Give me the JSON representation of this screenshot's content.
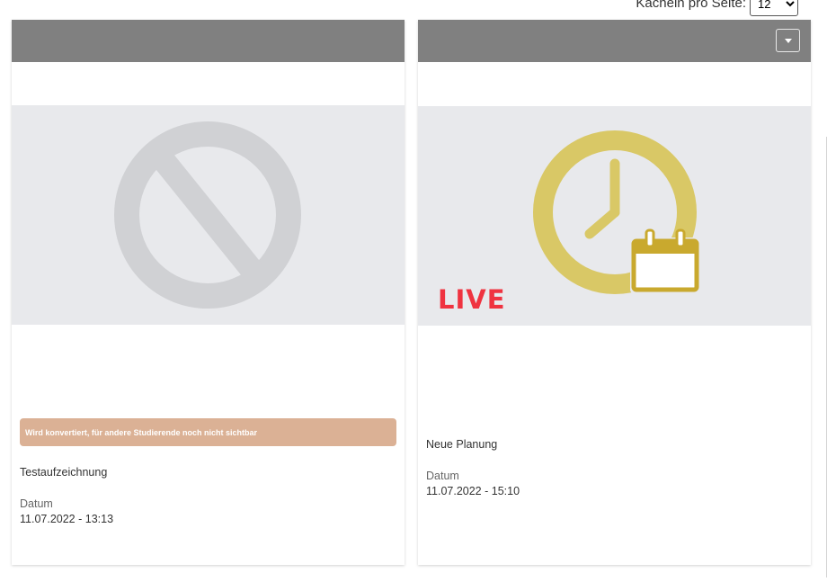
{
  "pagination": {
    "tiles_per_page_label": "Kacheln pro Seite:",
    "tiles_per_page_value": "12",
    "tiles_per_page_options": [
      "12"
    ]
  },
  "cards": [
    {
      "status_banner": "Wird konvertiert, für andere Studierende noch nicht sichtbar",
      "title": "Testaufzeichnung",
      "date_label": "Datum",
      "date_value": "11.07.2022 - 13:13",
      "thumbnail_icon": "unavailable-icon"
    },
    {
      "live_badge": "LIVE",
      "title": "Neue Planung",
      "date_label": "Datum",
      "date_value": "11.07.2022 - 15:10",
      "thumbnail_icon": "scheduled-clock-calendar-icon"
    }
  ],
  "colors": {
    "header_gray": "#808080",
    "thumb_bg": "#e8e9ec",
    "banner_bg": "#dbb195",
    "clock_yellow": "#d9c866",
    "calendar_gold": "#c9a92e",
    "live_red": "#ef3340"
  }
}
